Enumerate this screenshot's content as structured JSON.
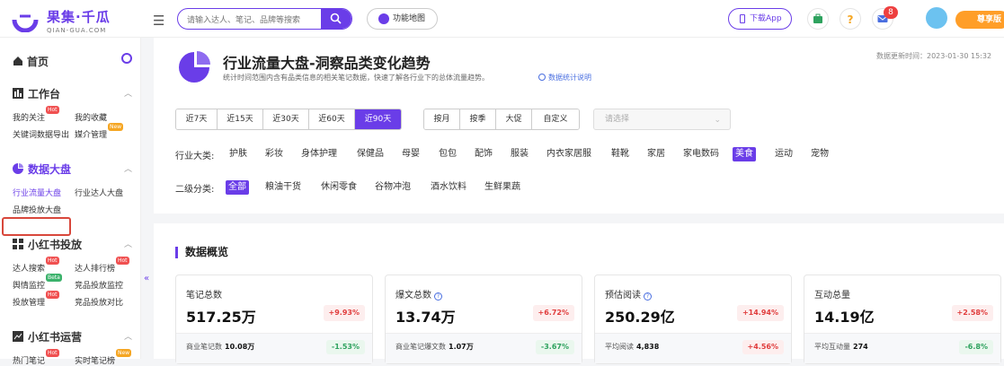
{
  "brand": {
    "name": "果集·千瓜",
    "domain": "QIAN-GUA.COM",
    "color": "#6a3de8"
  },
  "header": {
    "search_placeholder": "请输入达人、笔记、品牌等搜索",
    "func_map_label": "功能地图",
    "download_app_label": "下载App",
    "message_count": "8",
    "vip_label": "尊享版"
  },
  "sidebar": {
    "home": "首页",
    "workbench": {
      "title": "工作台",
      "items": [
        "我的关注",
        "我的收藏",
        "关键词数据导出",
        "媒介管理"
      ]
    },
    "data_board": {
      "title": "数据大盘",
      "items": [
        "行业流量大盘",
        "行业达人大盘",
        "品牌投放大盘"
      ]
    },
    "xhs_ads": {
      "title": "小红书投放",
      "items": [
        "达人搜索",
        "达人排行榜",
        "舆情监控",
        "竞品投放监控",
        "投放管理",
        "竞品投放对比"
      ]
    },
    "xhs_ops": {
      "title": "小红书运营",
      "items": [
        "热门笔记",
        "实时笔记榜"
      ]
    },
    "tags": {
      "hot": "Hot",
      "new": "New",
      "beta": "Beta"
    }
  },
  "page": {
    "title": "行业流量大盘-洞察品类变化趋势",
    "subtitle": "统计时间范围内含有品类信息的相关笔记数据，快速了解各行业下的总体流量趋势。",
    "data_link": "数据统计说明",
    "update_time": "数据更新时间：2023-01-30 15:32"
  },
  "time_ranges": [
    "近7天",
    "近15天",
    "近30天",
    "近60天",
    "近90天"
  ],
  "time_active": "近90天",
  "period_types": [
    "按月",
    "按季",
    "大促",
    "自定义"
  ],
  "select_placeholder": "请选择",
  "filters": {
    "industry_label": "行业大类:",
    "industries": [
      "护肤",
      "彩妆",
      "身体护理",
      "保健品",
      "母婴",
      "包包",
      "配饰",
      "服装",
      "内衣家居服",
      "鞋靴",
      "家居",
      "家电数码",
      "美食",
      "运动",
      "宠物"
    ],
    "industry_active": "美食",
    "sub_label": "二级分类:",
    "subs": [
      "全部",
      "粮油干货",
      "休闲零食",
      "谷物冲泡",
      "酒水饮料",
      "生鲜果蔬"
    ],
    "sub_active": "全部"
  },
  "overview": {
    "title": "数据概览",
    "cards": [
      {
        "label": "笔记总数",
        "value": "517.25万",
        "change": "+9.93%",
        "sub_label": "商业笔记数",
        "sub_value": "10.08万",
        "sub_change": "-1.53%"
      },
      {
        "label": "爆文总数",
        "value": "13.74万",
        "change": "+6.72%",
        "sub_label": "商业笔记爆文数",
        "sub_value": "1.07万",
        "sub_change": "-3.67%"
      },
      {
        "label": "预估阅读",
        "value": "250.29亿",
        "change": "+14.94%",
        "sub_label": "平均阅读",
        "sub_value": "4,838",
        "sub_change": "+4.56%"
      },
      {
        "label": "互动总量",
        "value": "14.19亿",
        "change": "+2.58%",
        "sub_label": "平均互动量",
        "sub_value": "274",
        "sub_change": "-6.8%"
      }
    ]
  }
}
